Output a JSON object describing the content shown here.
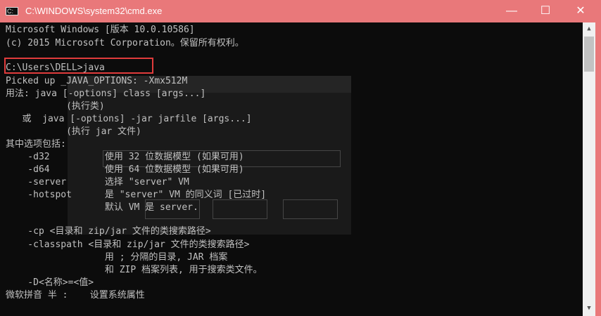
{
  "window": {
    "title": "C:\\WINDOWS\\system32\\cmd.exe",
    "icon": "cmd-icon",
    "accent_color": "#e9787a",
    "controls": {
      "minimize": "—",
      "maximize": "☐",
      "close": "✕"
    }
  },
  "console": {
    "lines": [
      "Microsoft Windows [版本 10.0.10586]",
      "(c) 2015 Microsoft Corporation。保留所有权利。",
      "",
      "C:\\Users\\DELL>java",
      "Picked up _JAVA_OPTIONS: -Xmx512M",
      "用法: java [-options] class [args...]",
      "           (执行类)",
      "   或  java [-options] -jar jarfile [args...]",
      "           (执行 jar 文件)",
      "其中选项包括:",
      "    -d32          使用 32 位数据模型 (如果可用)",
      "    -d64          使用 64 位数据模型 (如果可用)",
      "    -server       选择 \"server\" VM",
      "    -hotspot      是 \"server\" VM 的同义词 [已过时]",
      "                  默认 VM 是 server.",
      "",
      "    -cp <目录和 zip/jar 文件的类搜索路径>",
      "    -classpath <目录和 zip/jar 文件的类搜索路径>",
      "                  用 ; 分隔的目录, JAR 档案",
      "                  和 ZIP 档案列表, 用于搜索类文件。",
      "    -D<名称>=<值>",
      "微软拼音 半 :    设置系统属性"
    ],
    "text_color": "#c0c0c0",
    "background_color": "#0c0c0c",
    "highlight_color": "#e03c3c"
  },
  "scrollbar": {
    "up_icon": "▲",
    "down_icon": "▼"
  }
}
